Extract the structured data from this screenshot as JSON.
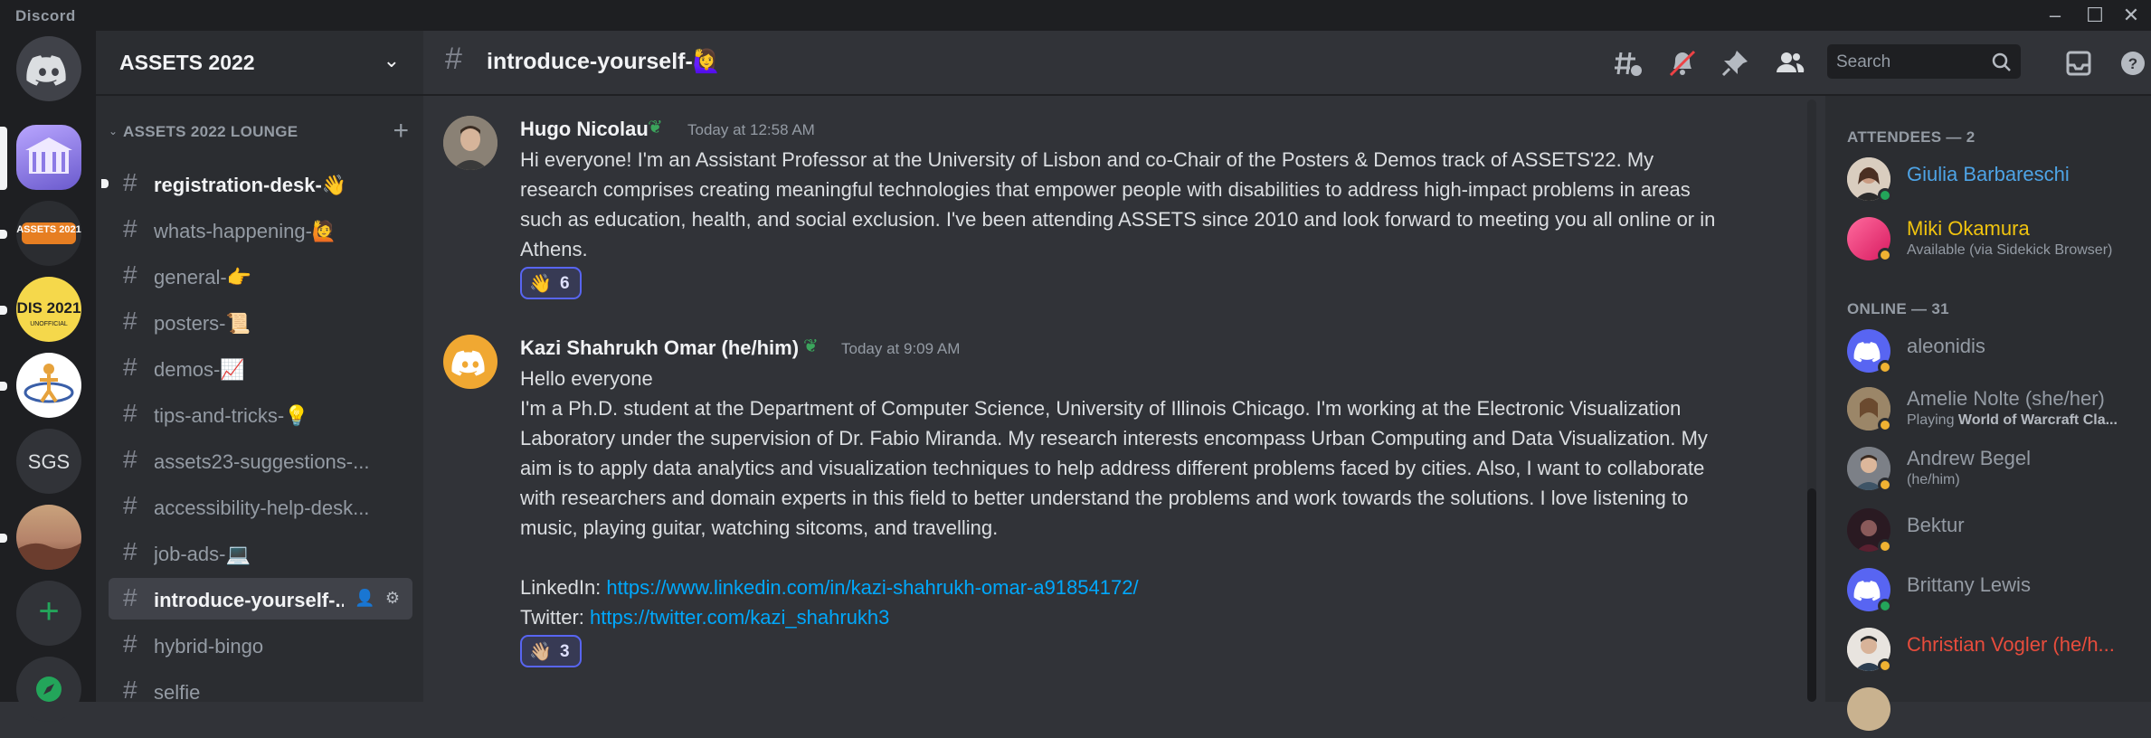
{
  "app": {
    "title": "Discord"
  },
  "servers": {
    "items": [
      {
        "name": "Direct Messages",
        "icon": "discord-logo-icon"
      },
      {
        "name": "ASSETS 2022",
        "icon": "assets-2022-server-icon"
      },
      {
        "name": "ASSETS 2021",
        "icon": "assets-2021-server-icon",
        "label": "ASSETS 2021"
      },
      {
        "name": "DIS 2021",
        "icon": "dis-2021-server-icon",
        "label": "DIS 2021",
        "sub": "UNOFFICIAL"
      },
      {
        "name": "Figure server",
        "icon": "figure-server-icon"
      },
      {
        "name": "SGS",
        "icon": "sgs-server-icon",
        "label": "SGS"
      },
      {
        "name": "Landscape server",
        "icon": "landscape-server-icon"
      }
    ],
    "add_server_label": "+",
    "explore_label": "Explore"
  },
  "guild": {
    "name": "ASSETS 2022",
    "category": "ASSETS 2022 LOUNGE",
    "channels": [
      {
        "name": "registration-desk-👋",
        "state": "unread"
      },
      {
        "name": "whats-happening-🙋",
        "state": "normal"
      },
      {
        "name": "general-👉",
        "state": "normal"
      },
      {
        "name": "posters-📜",
        "state": "normal"
      },
      {
        "name": "demos-📈",
        "state": "normal"
      },
      {
        "name": "tips-and-tricks-💡",
        "state": "normal"
      },
      {
        "name": "assets23-suggestions-...",
        "state": "normal"
      },
      {
        "name": "accessibility-help-desk...",
        "state": "normal"
      },
      {
        "name": "job-ads-💻",
        "state": "normal"
      },
      {
        "name": "introduce-yourself-...",
        "state": "active"
      },
      {
        "name": "hybrid-bingo",
        "state": "normal"
      },
      {
        "name": "selfie",
        "state": "normal"
      }
    ]
  },
  "header": {
    "channel_title": "introduce-yourself-🙋‍♀️",
    "search_placeholder": "Search"
  },
  "messages": [
    {
      "author": "Hugo Nicolau",
      "timestamp": "Today at 12:58 AM",
      "text": "Hi everyone! I'm an Assistant Professor at the University of Lisbon and co-Chair of the Posters & Demos track of ASSETS'22. My research comprises creating meaningful technologies that empower people with disabilities to address high-impact problems in areas such as education, health, and social exclusion. I've been attending ASSETS since 2010 and look forward to meeting you all online or in Athens.",
      "reaction": {
        "emoji": "👋",
        "count": "6"
      }
    },
    {
      "author": "Kazi Shahrukh Omar (he/him)",
      "timestamp": "Today at 9:09 AM",
      "line1": "Hello everyone",
      "text": "I'm a Ph.D. student at the Department of Computer Science, University of Illinois Chicago. I'm working at the Electronic Visualization Laboratory under the supervision of Dr. Fabio Miranda. My research interests encompass Urban Computing and Data Visualization. My aim is to apply data analytics and visualization techniques to help address different problems faced by cities. Also, I want to collaborate with researchers and domain experts in this field to better understand the problems and work towards the solutions. I love listening to music, playing guitar, watching sitcoms, and travelling.",
      "linkedin_label": "LinkedIn:",
      "linkedin_url": "https://www.linkedin.com/in/kazi-shahrukh-omar-a91854172/",
      "twitter_label": "Twitter:",
      "twitter_url": "https://twitter.com/kazi_shahrukh3",
      "reaction": {
        "emoji": "👋🏼",
        "count": "3"
      }
    }
  ],
  "members": {
    "attendees_header": "ATTENDEES — 2",
    "online_header": "ONLINE — 31",
    "attendees": [
      {
        "name": "Giulia Barbareschi",
        "color": "#4ea4e6",
        "status": "online"
      },
      {
        "name": "Miki Okamura",
        "color": "#f1c40f",
        "status": "idle",
        "activity": "Available (via Sidekick Browser)"
      }
    ],
    "online": [
      {
        "name": "aleonidis",
        "status": "idle"
      },
      {
        "name": "Amelie Nolte (she/her)",
        "status": "idle",
        "activity_prefix": "Playing ",
        "activity_bold": "World of Warcraft Cla..."
      },
      {
        "name": "Andrew Begel",
        "status": "idle",
        "activity": "(he/him)"
      },
      {
        "name": "Bektur",
        "status": "idle"
      },
      {
        "name": "Brittany Lewis",
        "status": "online"
      },
      {
        "name": "Christian Vogler (he/h...",
        "color": "#e74c3c",
        "status": "idle"
      }
    ]
  },
  "colors": {
    "blurple": "#5865f2",
    "online": "#23a55a",
    "idle": "#f0b232",
    "link": "#00a8fc"
  }
}
